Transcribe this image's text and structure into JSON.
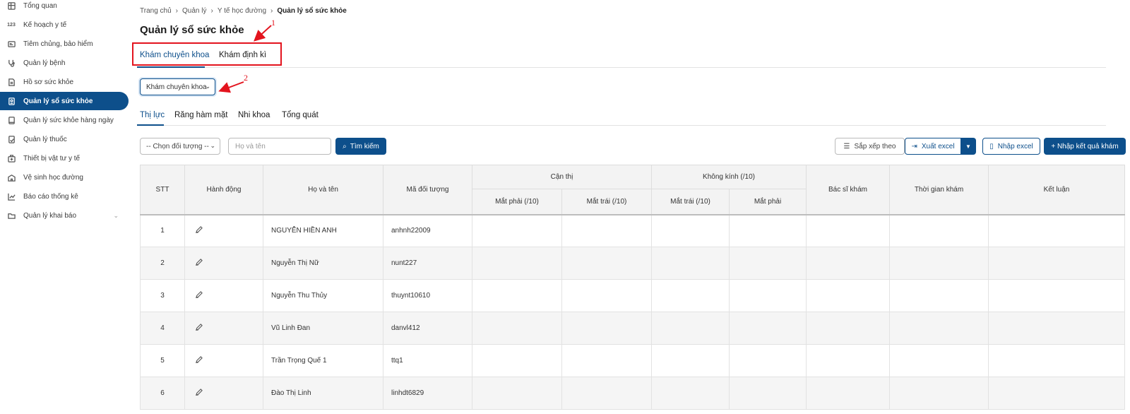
{
  "sidebar": {
    "items": [
      {
        "label": "Tổng quan",
        "icon": "grid-icon",
        "active": false
      },
      {
        "label": "Kế hoạch y tế",
        "icon": "numbers-icon",
        "active": false
      },
      {
        "label": "Tiêm chủng, bảo hiểm",
        "icon": "id-card-icon",
        "active": false
      },
      {
        "label": "Quản lý bệnh",
        "icon": "stethoscope-icon",
        "active": false
      },
      {
        "label": "Hồ sơ sức khỏe",
        "icon": "document-icon",
        "active": false
      },
      {
        "label": "Quản lý sổ sức khỏe",
        "icon": "health-book-icon",
        "active": true
      },
      {
        "label": "Quản lý sức khỏe hàng ngày",
        "icon": "tablet-icon",
        "active": false
      },
      {
        "label": "Quản lý thuốc",
        "icon": "pill-icon",
        "active": false
      },
      {
        "label": "Thiết bị vật tư y tế",
        "icon": "medical-kit-icon",
        "active": false
      },
      {
        "label": "Vệ sinh học đường",
        "icon": "school-icon",
        "active": false
      },
      {
        "label": "Báo cáo thống kê",
        "icon": "chart-icon",
        "active": false
      },
      {
        "label": "Quản lý khai báo",
        "icon": "folder-icon",
        "active": false
      }
    ]
  },
  "breadcrumb": [
    "Trang chủ",
    "Quản lý",
    "Y tế học đường",
    "Quản lý sổ sức khỏe"
  ],
  "page_title": "Quản lý sổ sức khỏe",
  "top_tabs": [
    "Khám chuyên khoa",
    "Khám định kì"
  ],
  "exam_type_select": "Khám chuyên khoa",
  "annotations": {
    "one": "1",
    "two": "2"
  },
  "sub_tabs": [
    "Thị lực",
    "Răng hàm mặt",
    "Nhi khoa",
    "Tổng quát"
  ],
  "filters": {
    "object_select": "-- Chọn đối tượng --",
    "name_placeholder": "Họ và tên",
    "search_button": "Tìm kiếm"
  },
  "actions": {
    "sort": "Sắp xếp theo",
    "export": "Xuất excel",
    "import": "Nhập excel",
    "add_result": "+ Nhập kết quả khám"
  },
  "colors": {
    "primary": "#0d4f8b",
    "annotation": "#e3141e"
  },
  "table": {
    "headers": {
      "stt": "STT",
      "action": "Hành động",
      "name": "Họ và tên",
      "code": "Mã đối tượng",
      "myopia": "Cận thị",
      "no_glasses": "Không kính (/10)",
      "right_eye_10": "Mắt phải (/10)",
      "left_eye_10": "Mắt trái (/10)",
      "left_eye_10b": "Mắt trái (/10)",
      "right_eye": "Mắt phải",
      "doctor": "Bác sĩ khám",
      "time": "Thời gian khám",
      "conclusion": "Kết luận"
    },
    "rows": [
      {
        "stt": "1",
        "name": "NGUYỄN HIỀN ANH",
        "code": "anhnh22009"
      },
      {
        "stt": "2",
        "name": "Nguyễn Thị Nữ",
        "code": "nunt227"
      },
      {
        "stt": "3",
        "name": "Nguyễn Thu Thủy",
        "code": "thuynt10610"
      },
      {
        "stt": "4",
        "name": "Vũ Linh Đan",
        "code": "danvl412"
      },
      {
        "stt": "5",
        "name": "Trần Trọng Quế 1",
        "code": "ttq1"
      },
      {
        "stt": "6",
        "name": "Đào Thị Linh",
        "code": "linhdt6829"
      }
    ]
  }
}
